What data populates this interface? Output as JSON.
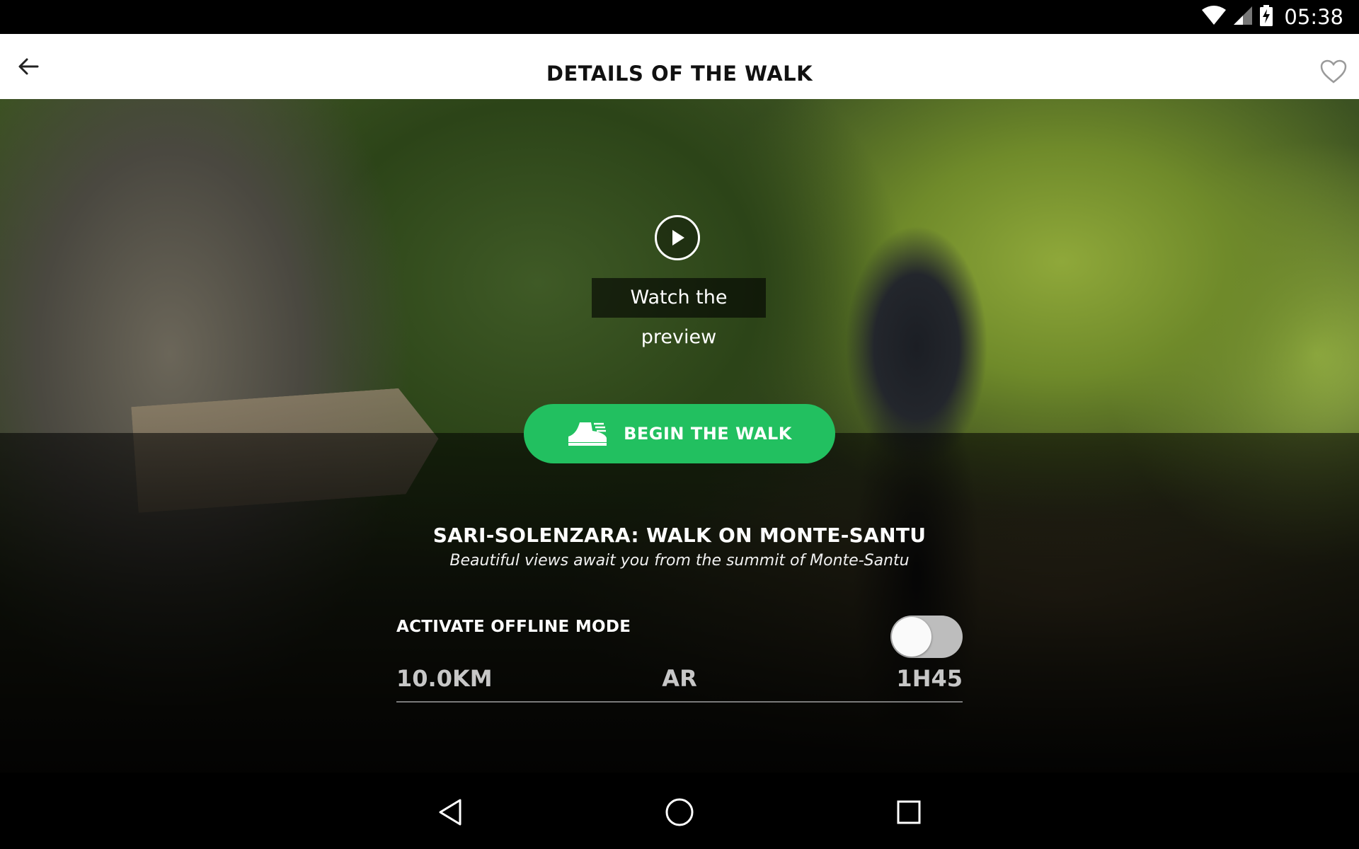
{
  "status_bar": {
    "time": "05:38",
    "icons": [
      "wifi-icon",
      "signal-icon",
      "battery-charging-icon"
    ]
  },
  "app_bar": {
    "title": "DETAILS OF THE WALK",
    "back_icon": "arrow-back-icon",
    "favorite_icon": "heart-outline-icon"
  },
  "hero": {
    "play_icon": "play-circle-icon",
    "preview_label": "Watch the preview",
    "begin_button": {
      "label": "BEGIN THE WALK",
      "icon": "boot-icon",
      "color": "#22c060"
    },
    "walk_title": "SARI-SOLENZARA: WALK ON MONTE-SANTU",
    "walk_subtitle": "Beautiful views await you from the summit of Monte-Santu",
    "offline": {
      "label": "ACTIVATE OFFLINE MODE",
      "enabled": false
    },
    "stats": {
      "distance": "10.0KM",
      "type": "AR",
      "duration": "1H45"
    }
  },
  "nav_bar": {
    "icons": [
      "nav-back-icon",
      "nav-home-icon",
      "nav-recents-icon"
    ]
  }
}
